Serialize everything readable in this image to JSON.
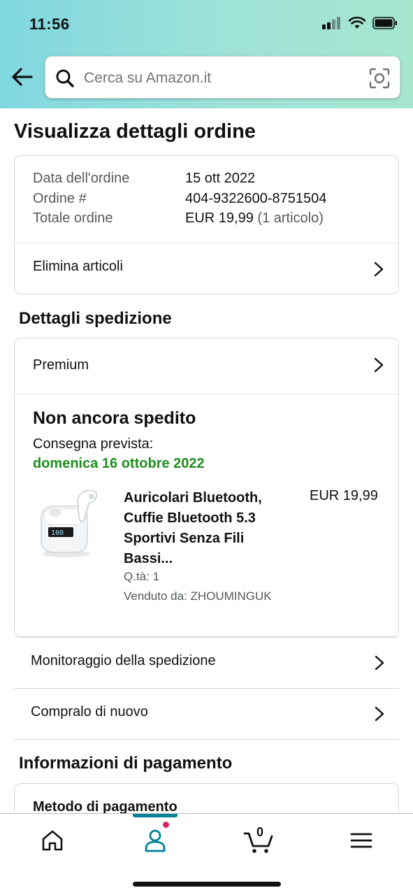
{
  "status_bar": {
    "time": "11:56"
  },
  "search": {
    "placeholder": "Cerca su Amazon.it"
  },
  "page_title": "Visualizza dettagli ordine",
  "order_summary": {
    "date_label": "Data dell'ordine",
    "date_value": "15 ott 2022",
    "order_label": "Ordine #",
    "order_value": "404-9322600-8751504",
    "total_label": "Totale ordine",
    "total_value": "EUR 19,99",
    "total_items": "(1 articolo)",
    "delete_items_label": "Elimina articoli"
  },
  "shipping": {
    "section_title": "Dettagli spedizione",
    "service": "Premium",
    "status": "Non ancora spedito",
    "delivery_label": "Consegna prevista:",
    "delivery_date": "domenica 16 ottobre 2022",
    "product": {
      "title": "Auricolari Bluetooth, Cuffie Bluetooth 5.3 Sportivi Senza Fili Bassi...",
      "price": "EUR 19,99",
      "qty": "Q.tà: 1",
      "seller": "Venduto da: ZHOUMINGUK",
      "case_display": "100"
    }
  },
  "actions": {
    "track": "Monitoraggio della spedizione",
    "buy_again": "Compralo di nuovo"
  },
  "payment": {
    "section_title": "Informazioni di pagamento",
    "method_label": "Metodo di pagamento"
  },
  "bottom_nav": {
    "cart_count": "0",
    "active_color": "#008296",
    "badge_color": "#e3225c"
  },
  "colors": {
    "delivery_green": "#1e8e1e",
    "header_gradient": [
      "#80d7e0",
      "#a6e6cf"
    ]
  }
}
